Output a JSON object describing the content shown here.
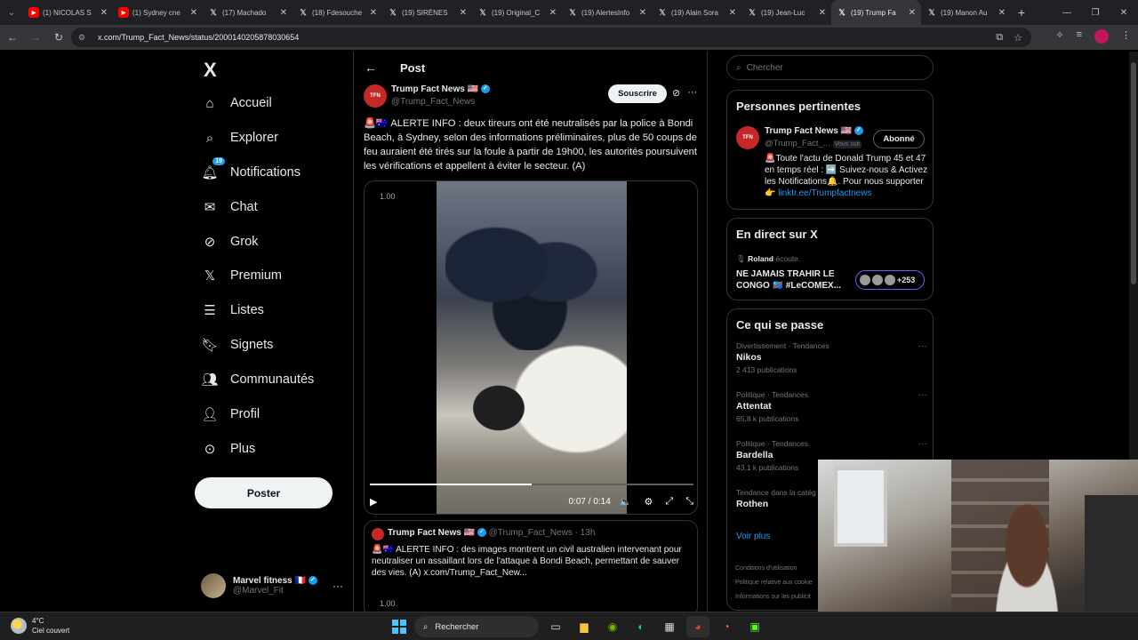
{
  "browser": {
    "tabs": [
      {
        "title": "(1) NICOLAS S",
        "icon": "youtube-icon"
      },
      {
        "title": "(1) Sydney cne",
        "icon": "youtube-icon"
      },
      {
        "title": "(17) Machado",
        "icon": "x-icon"
      },
      {
        "title": "(18) Fdesouche",
        "icon": "x-icon"
      },
      {
        "title": "(19) SIRÈNES",
        "icon": "x-icon"
      },
      {
        "title": "(19) Original_C",
        "icon": "x-icon"
      },
      {
        "title": "(19) AlertesInfo",
        "icon": "x-icon"
      },
      {
        "title": "(19) Alain Sora",
        "icon": "x-icon"
      },
      {
        "title": "(19) Jean-Luc",
        "icon": "x-icon"
      },
      {
        "title": "(19) Trump Fa",
        "icon": "x-icon",
        "active": true
      },
      {
        "title": "(19) Manon Au",
        "icon": "x-icon"
      }
    ],
    "url": "x.com/Trump_Fact_News/status/2000140205878030654"
  },
  "sidebar": {
    "logo": "X",
    "items": [
      {
        "label": "Accueil",
        "icon": "home-icon"
      },
      {
        "label": "Explorer",
        "icon": "search-icon"
      },
      {
        "label": "Notifications",
        "icon": "bell-icon",
        "badge": "19"
      },
      {
        "label": "Chat",
        "icon": "mail-icon"
      },
      {
        "label": "Grok",
        "icon": "grok-icon"
      },
      {
        "label": "Premium",
        "icon": "x-premium-icon"
      },
      {
        "label": "Listes",
        "icon": "list-icon"
      },
      {
        "label": "Signets",
        "icon": "bookmark-icon"
      },
      {
        "label": "Communautés",
        "icon": "communities-icon"
      },
      {
        "label": "Profil",
        "icon": "person-icon"
      },
      {
        "label": "Plus",
        "icon": "more-circle-icon"
      }
    ],
    "post_button": "Poster",
    "account": {
      "name": "Marvel fitness 🇫🇷",
      "handle": "@Marvel_Fit"
    }
  },
  "post": {
    "header": "Post",
    "author_name": "Trump Fact News 🇺🇸",
    "author_handle": "@Trump_Fact_News",
    "avatar_text": "TFN",
    "subscribe_label": "Souscrire",
    "text": "🚨🇦🇺 ALERTE INFO : deux tireurs ont été neutralisés par la police à Bondi Beach, à Sydney, selon des informations préliminaires, plus de 50 coups de feu auraient été tirés sur la foule à partir de 19h00, les autorités poursuivent les vérifications et appellent à éviter le secteur. (A)",
    "video": {
      "speed": "1.00",
      "time": "0:07 / 0:14",
      "progress": 0.5
    },
    "quote": {
      "author_name": "Trump Fact News 🇺🇸",
      "author_handle": "@Trump_Fact_News · 13h",
      "text": "🚨🇦🇺 ALERTE INFO : des images montrent un civil australien intervenant pour neutraliser un assaillant lors de l'attaque à Bondi Beach, permettant de sauver des vies. (A)  x.com/Trump_Fact_New...",
      "speed": "1.00"
    }
  },
  "right": {
    "search_placeholder": "Chercher",
    "relevant": {
      "title": "Personnes pertinentes",
      "name": "Trump Fact News 🇺🇸",
      "handle": "@Trump_Fact_...",
      "follows_you": "Vous suit",
      "button": "Abonné",
      "bio": "🚨Toute l'actu de Donald Trump 45 et 47 en temps réel : ➡️ Suivez-nous & Activez les Notifications🔔. Pour nous supporter👉",
      "bio_link": "linktr.ee/Trumpfactnews"
    },
    "live": {
      "title": "En direct sur X",
      "user": "Roland",
      "user_suffix": "écoute.",
      "space_title": "NE JAMAIS TRAHIR LE CONGO 🇨🇩 #LeCOMEX...",
      "count": "+253"
    },
    "trends": {
      "title": "Ce qui se passe",
      "items": [
        {
          "category": "Divertissement · Tendances",
          "name": "Nikos",
          "count": "2 413 publications"
        },
        {
          "category": "Politique · Tendances",
          "name": "Attentat",
          "count": "65,8 k publications"
        },
        {
          "category": "Politique · Tendances",
          "name": "Bardella",
          "count": "43,1 k publications"
        },
        {
          "category": "Tendance dans la catég",
          "name": "Rothen",
          "count": ""
        }
      ],
      "see_more": "Voir plus"
    },
    "footer": [
      "Conditions d'utilisation",
      "Politique relative aux cookie",
      "Informations sur les publicit"
    ]
  },
  "taskbar": {
    "weather_temp": "4°C",
    "weather_desc": "Ciel couvert",
    "weather_badge": "1",
    "search": "Rechercher"
  }
}
